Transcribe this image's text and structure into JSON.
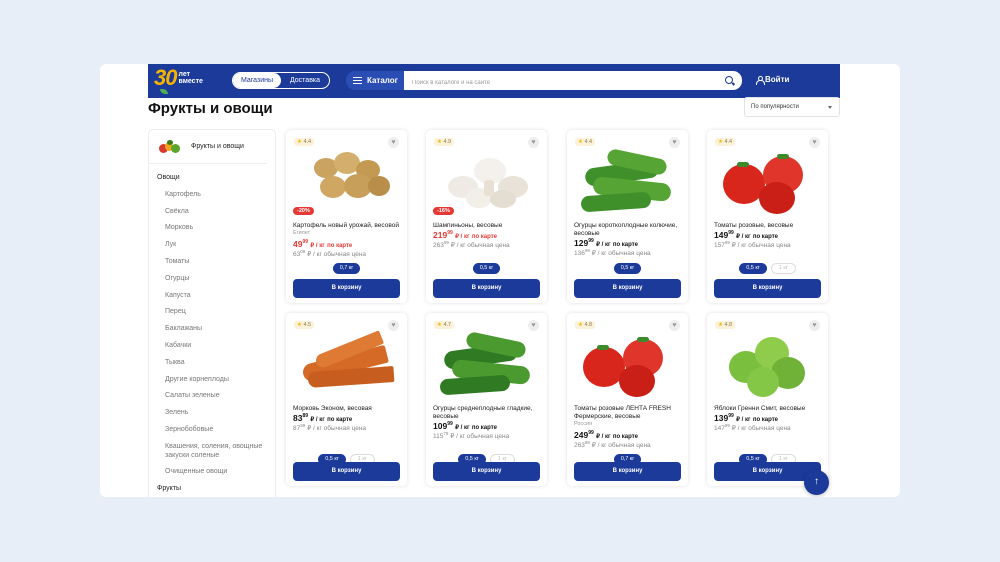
{
  "header": {
    "logo_number": "30",
    "logo_text_1": "лет",
    "logo_text_2": "вместе",
    "seg_stores": "Магазины",
    "seg_delivery": "Доставка",
    "catalog_label": "Каталог",
    "search_placeholder": "Поиск в каталоге и на сайте",
    "login_label": "Войти",
    "brand_color": "#1b3a9a"
  },
  "page": {
    "title": "Фрукты и овощи",
    "sort_value": "По популярности"
  },
  "sidebar": {
    "head_label": "Фрукты и овощи",
    "items": [
      {
        "label": "Овощи",
        "cat": true
      },
      {
        "label": "Картофель",
        "cat": false
      },
      {
        "label": "Свёкла",
        "cat": false
      },
      {
        "label": "Морковь",
        "cat": false
      },
      {
        "label": "Лук",
        "cat": false
      },
      {
        "label": "Томаты",
        "cat": false
      },
      {
        "label": "Огурцы",
        "cat": false
      },
      {
        "label": "Капуста",
        "cat": false
      },
      {
        "label": "Перец",
        "cat": false
      },
      {
        "label": "Баклажаны",
        "cat": false
      },
      {
        "label": "Кабачки",
        "cat": false
      },
      {
        "label": "Тыква",
        "cat": false
      },
      {
        "label": "Другие корнеплоды",
        "cat": false
      },
      {
        "label": "Салаты зеленые",
        "cat": false
      },
      {
        "label": "Зелень",
        "cat": false
      },
      {
        "label": "Зернобобовые",
        "cat": false
      },
      {
        "label": "Квашения, соления, овощные закуски соленые",
        "cat": false
      },
      {
        "label": "Очищенные овощи",
        "cat": false
      },
      {
        "label": "Фрукты",
        "cat": true
      }
    ]
  },
  "common": {
    "card_price_suffix": "₽ / кг",
    "by_card": "по карте",
    "regular_suffix": "₽ / кг обычная цена",
    "add_to_cart": "В корзину",
    "weight_small": "0,5 кг",
    "weight_large": "1 кг",
    "weight_07": "0,7 кг"
  },
  "products": [
    {
      "rating": "4.4",
      "badge": "-20%",
      "name": "Картофель новый урожай, весовой",
      "origin": "Египет",
      "price_int": "49",
      "price_frac": "99",
      "sale": true,
      "regular_int": "63",
      "regular_frac": "09",
      "weights": [
        "0,7 кг"
      ],
      "img": "potato"
    },
    {
      "rating": "4.9",
      "badge": "-16%",
      "name": "Шампиньоны, весовые",
      "origin": "",
      "price_int": "219",
      "price_frac": "99",
      "sale": true,
      "regular_int": "263",
      "regular_frac": "99",
      "weights": [
        "0,5 кг"
      ],
      "img": "mushroom"
    },
    {
      "rating": "4.4",
      "badge": "",
      "name": "Огурцы короткоплодные колючие, весовые",
      "origin": "",
      "price_int": "129",
      "price_frac": "99",
      "sale": false,
      "regular_int": "136",
      "regular_frac": "99",
      "weights": [
        "0,5 кг"
      ],
      "img": "cucumber"
    },
    {
      "rating": "4.4",
      "badge": "",
      "name": "Томаты розовые, весовые",
      "origin": "",
      "price_int": "149",
      "price_frac": "99",
      "sale": false,
      "regular_int": "157",
      "regular_frac": "99",
      "weights": [
        "0,5 кг",
        "1 кг"
      ],
      "img": "tomato"
    },
    {
      "rating": "4.5",
      "badge": "",
      "name": "Морковь Эконом, весовая",
      "origin": "",
      "price_int": "83",
      "price_frac": "89",
      "sale": false,
      "regular_int": "87",
      "regular_frac": "99",
      "weights": [
        "0,5 кг",
        "1 кг"
      ],
      "img": "carrot"
    },
    {
      "rating": "4.7",
      "badge": "",
      "name": "Огурцы среднеплодные гладкие, весовые",
      "origin": "",
      "price_int": "109",
      "price_frac": "99",
      "sale": false,
      "regular_int": "115",
      "regular_frac": "79",
      "weights": [
        "0,5 кг",
        "1 кг"
      ],
      "img": "cucumber2"
    },
    {
      "rating": "4.8",
      "badge": "",
      "name": "Томаты розовые ЛЕНТА FRESH Фермерские, весовые",
      "origin": "Россия",
      "price_int": "249",
      "price_frac": "99",
      "sale": false,
      "regular_int": "263",
      "regular_frac": "99",
      "weights": [
        "0,7 кг"
      ],
      "img": "tomato2"
    },
    {
      "rating": "4.8",
      "badge": "",
      "name": "Яблоки Гренни Смит, весовые",
      "origin": "",
      "price_int": "139",
      "price_frac": "99",
      "sale": false,
      "regular_int": "147",
      "regular_frac": "99",
      "weights": [
        "0,5 кг",
        "1 кг"
      ],
      "img": "apple"
    }
  ]
}
